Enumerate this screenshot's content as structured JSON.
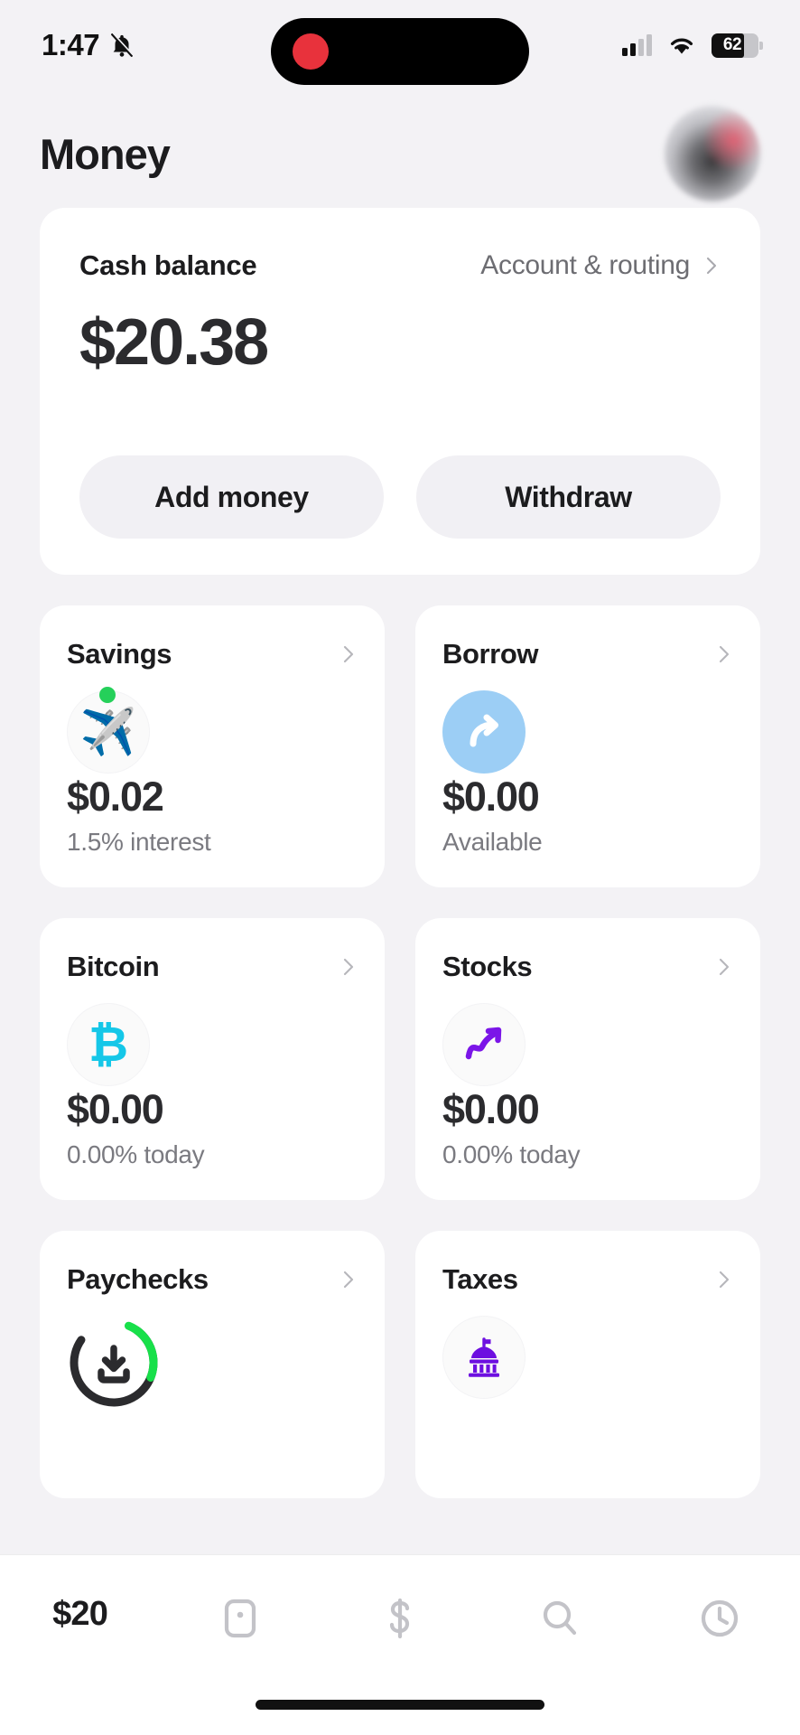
{
  "status_bar": {
    "time": "1:47",
    "silent_icon": "bell-slash-icon",
    "signal_icon": "cellular-signal-icon",
    "wifi_icon": "wifi-icon",
    "battery_level": "62",
    "recording_dot_color": "#e8323c"
  },
  "header": {
    "title": "Money",
    "avatar_label": "profile-avatar"
  },
  "balance_card": {
    "label": "Cash balance",
    "account_routing_label": "Account & routing",
    "amount": "$20.38",
    "add_money_label": "Add money",
    "withdraw_label": "Withdraw"
  },
  "tiles": [
    {
      "id": "savings",
      "title": "Savings",
      "icon": "airplane-emoji-icon",
      "badge_color": "#25d05a",
      "amount": "$0.02",
      "subtitle": "1.5% interest"
    },
    {
      "id": "borrow",
      "title": "Borrow",
      "icon": "curved-arrow-icon",
      "icon_bg": "#9ccef5",
      "amount": "$0.00",
      "subtitle": "Available"
    },
    {
      "id": "bitcoin",
      "title": "Bitcoin",
      "icon": "bitcoin-icon",
      "icon_color": "#15c7e8",
      "amount": "$0.00",
      "subtitle": "0.00% today"
    },
    {
      "id": "stocks",
      "title": "Stocks",
      "icon": "stock-trend-icon",
      "icon_color": "#7b15e8",
      "amount": "$0.00",
      "subtitle": "0.00% today"
    },
    {
      "id": "paychecks",
      "title": "Paychecks",
      "icon": "direct-deposit-ring-icon",
      "ring_color": "#18e04a",
      "ring_progress": "25"
    },
    {
      "id": "taxes",
      "title": "Taxes",
      "icon": "government-building-icon",
      "icon_color": "#6d0fe0"
    }
  ],
  "tabbar": [
    {
      "id": "money",
      "label": "$20",
      "icon": "money-tab"
    },
    {
      "id": "card",
      "label": "",
      "icon": "card-icon"
    },
    {
      "id": "pay",
      "label": "",
      "icon": "dollar-icon"
    },
    {
      "id": "search",
      "label": "",
      "icon": "search-icon"
    },
    {
      "id": "activity",
      "label": "",
      "icon": "clock-icon"
    }
  ]
}
